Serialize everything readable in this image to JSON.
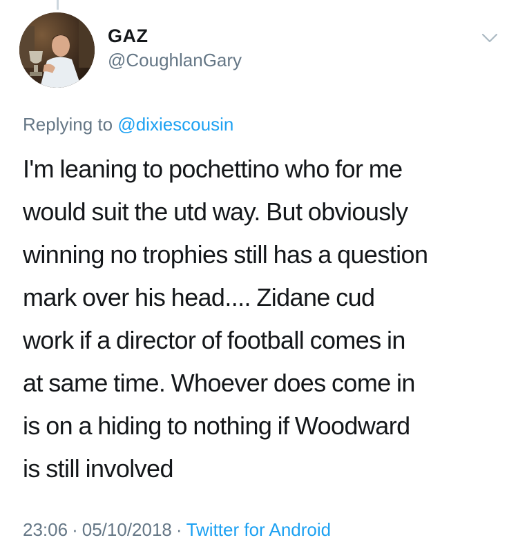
{
  "tweet": {
    "author": {
      "display_name": "GAZ",
      "handle": "@CoughlanGary"
    },
    "reply": {
      "prefix": "Replying to",
      "mention": "@dixiescousin"
    },
    "text_lines": [
      "I'm leaning to pochettino who for me",
      "would suit the utd way. But obviously",
      "winning no trophies still has a question",
      "mark over his head.... Zidane cud",
      "work if a director of football comes in",
      "at same time. Whoever does come in",
      "is on a hiding to nothing if Woodward",
      "is still involved"
    ],
    "meta": {
      "time": "23:06",
      "separator": "·",
      "date": "05/10/2018",
      "source": "Twitter for Android"
    }
  },
  "icons": {
    "menu": "chevron-down-icon",
    "avatar": "profile-photo"
  },
  "colors": {
    "text_primary": "#14171a",
    "text_secondary": "#657786",
    "link": "#1da1f2",
    "thread_line": "#ccd6dd"
  }
}
